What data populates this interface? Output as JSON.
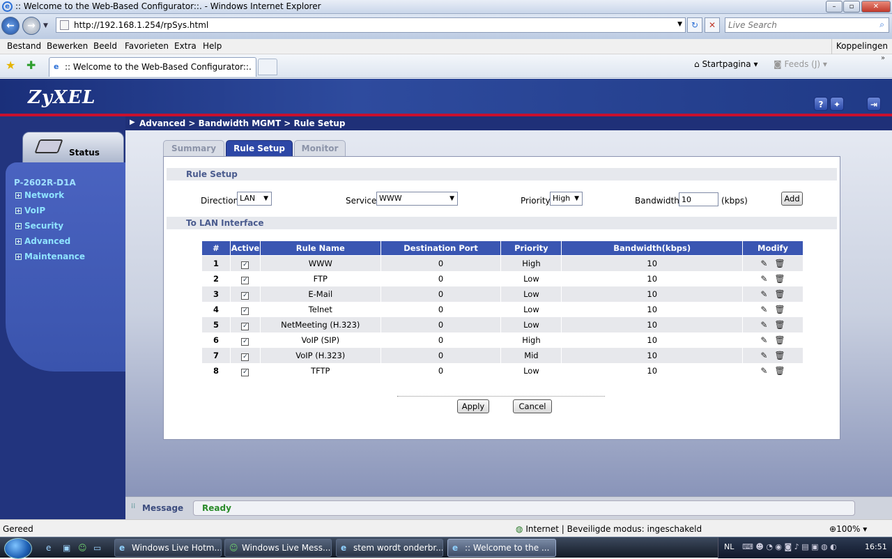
{
  "window": {
    "title": ":: Welcome to the Web-Based Configurator::. - Windows Internet Explorer"
  },
  "address": {
    "url": "http://192.168.1.254/rpSys.html",
    "search_placeholder": "Live Search"
  },
  "menu": {
    "items": [
      "Bestand",
      "Bewerken",
      "Beeld",
      "Favorieten",
      "Extra",
      "Help"
    ],
    "links": "Koppelingen"
  },
  "tabs": {
    "active_title": ":: Welcome to the Web-Based Configurator::.",
    "home": "Startpagina",
    "feeds": "Feeds (J)"
  },
  "header": {
    "logo": "ZyXEL"
  },
  "sidebar": {
    "status": "Status",
    "model": "P-2602R-D1A",
    "items": [
      {
        "label": "Network"
      },
      {
        "label": "VoIP"
      },
      {
        "label": "Security"
      },
      {
        "label": "Advanced"
      },
      {
        "label": "Maintenance"
      }
    ]
  },
  "breadcrumb": "Advanced > Bandwidth MGMT > Rule Setup",
  "pagetabs": {
    "summary": "Summary",
    "rule_setup": "Rule Setup",
    "monitor": "Monitor"
  },
  "rule_setup": {
    "heading": "Rule Setup",
    "direction_label": "Direction",
    "direction_value": "LAN",
    "service_label": "Service",
    "service_value": "WWW",
    "priority_label": "Priority",
    "priority_value": "High",
    "bandwidth_label": "Bandwidth",
    "bandwidth_value": "10",
    "unit": "(kbps)",
    "add": "Add"
  },
  "lan_table": {
    "heading": "To LAN Interface",
    "columns": [
      "#",
      "Active",
      "Rule Name",
      "Destination Port",
      "Priority",
      "Bandwidth(kbps)",
      "Modify"
    ],
    "rows": [
      {
        "num": "1",
        "name": "WWW",
        "port": "0",
        "priority": "High",
        "bw": "10"
      },
      {
        "num": "2",
        "name": "FTP",
        "port": "0",
        "priority": "Low",
        "bw": "10"
      },
      {
        "num": "3",
        "name": "E-Mail",
        "port": "0",
        "priority": "Low",
        "bw": "10"
      },
      {
        "num": "4",
        "name": "Telnet",
        "port": "0",
        "priority": "Low",
        "bw": "10"
      },
      {
        "num": "5",
        "name": "NetMeeting (H.323)",
        "port": "0",
        "priority": "Low",
        "bw": "10"
      },
      {
        "num": "6",
        "name": "VoIP (SIP)",
        "port": "0",
        "priority": "High",
        "bw": "10"
      },
      {
        "num": "7",
        "name": "VoIP (H.323)",
        "port": "0",
        "priority": "Mid",
        "bw": "10"
      },
      {
        "num": "8",
        "name": "TFTP",
        "port": "0",
        "priority": "Low",
        "bw": "10"
      }
    ]
  },
  "buttons": {
    "apply": "Apply",
    "cancel": "Cancel"
  },
  "message": {
    "label": "Message",
    "text": "Ready"
  },
  "statusbar": {
    "left": "Gereed",
    "zone": "Internet | Beveiligde modus: ingeschakeld",
    "zoom": "100%"
  },
  "taskbar": {
    "items": [
      "Windows Live Hotm...",
      "Windows Live Mess...",
      "stem wordt onderbr...",
      ":: Welcome to the ..."
    ],
    "lang": "NL",
    "clock": "16:51"
  }
}
